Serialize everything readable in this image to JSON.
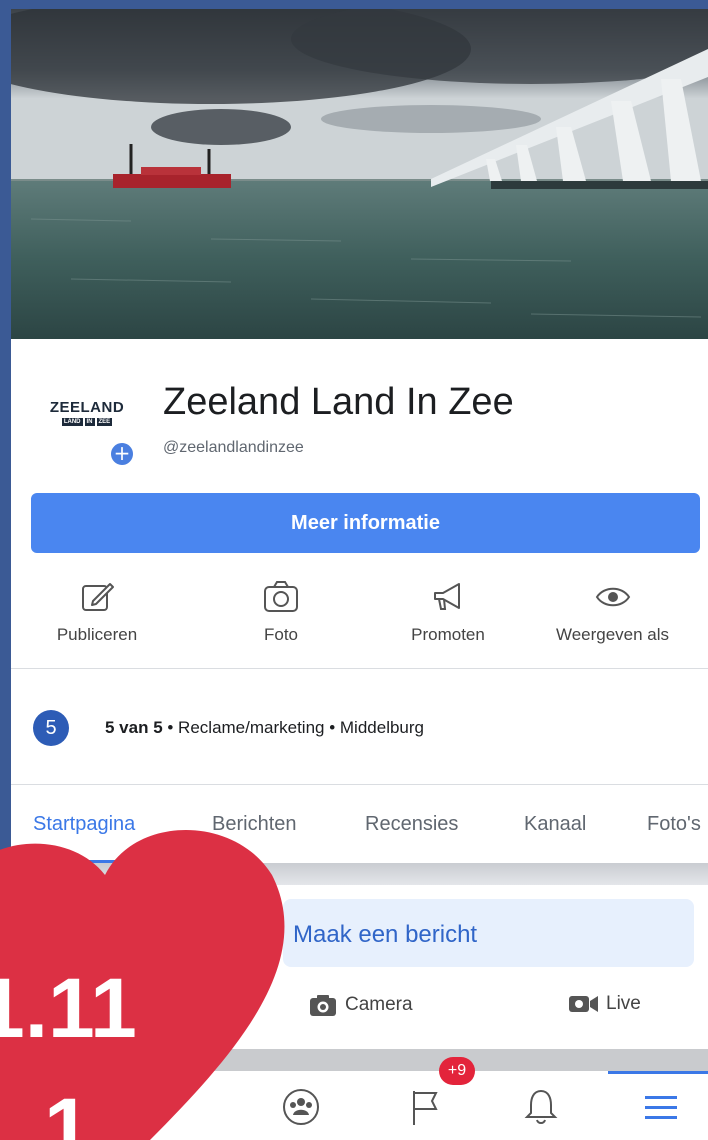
{
  "page": {
    "name": "Zeeland Land In Zee",
    "handle": "@zeelandlandinzee",
    "logo_line1": "ZEELAND",
    "logo_line2": [
      "LAND",
      "IN",
      "ZEE"
    ]
  },
  "cta": {
    "more_info_label": "Meer informatie"
  },
  "actions": [
    {
      "icon": "edit-icon",
      "label": "Publiceren"
    },
    {
      "icon": "camera-icon",
      "label": "Foto"
    },
    {
      "icon": "megaphone-icon",
      "label": "Promoten"
    },
    {
      "icon": "eye-icon",
      "label": "Weergeven als"
    }
  ],
  "rating": {
    "badge": "5",
    "score": "5 van 5",
    "details": " • Reclame/marketing • Middelburg"
  },
  "tabs": [
    "Startpagina",
    "Berichten",
    "Recensies",
    "Kanaal",
    "Foto's"
  ],
  "active_tab": "Startpagina",
  "composer": {
    "placeholder": "Maak een bericht",
    "camera_label": "Camera",
    "live_label": "Live"
  },
  "bottom_nav": {
    "items": [
      "groups-icon",
      "flag-icon",
      "bell-icon",
      "menu-icon"
    ],
    "notification_count": "+9"
  },
  "overlay": {
    "line1": "1.11",
    "line2": "1",
    "heart_color": "#dc3044"
  },
  "colors": {
    "accent": "#4a86f0",
    "frame": "#3b5a95",
    "badge": "#e3243b"
  }
}
